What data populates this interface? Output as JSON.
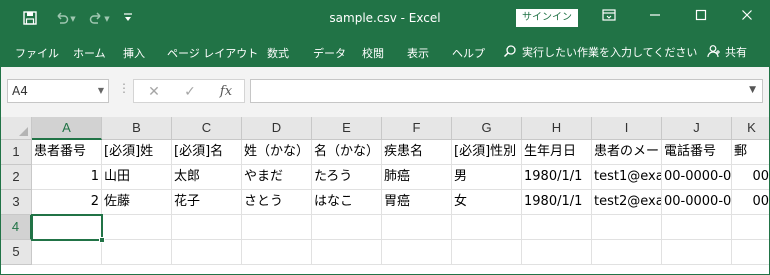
{
  "app": {
    "title": "sample.csv  -  Excel",
    "signin_label": "サインイン",
    "accent_color": "#217346"
  },
  "quick_access": {
    "save_icon": "save-icon",
    "undo_icon": "undo-icon",
    "redo_icon": "redo-icon",
    "customize_icon": "customize-qat-icon"
  },
  "window_controls": [
    "ribbon-display-options-icon",
    "minimize-icon",
    "maximize-icon",
    "close-icon"
  ],
  "ribbon": {
    "tabs": [
      "ファイル",
      "ホーム",
      "挿入",
      "ページ レイアウト",
      "数式",
      "データ",
      "校閲",
      "表示",
      "ヘルプ"
    ],
    "tell_me": "実行したい作業を入力してください",
    "share": "共有"
  },
  "formula_bar": {
    "name_box": "A4",
    "cancel_glyph": "✕",
    "enter_glyph": "✓",
    "fx_label": "fx",
    "formula_value": ""
  },
  "sheet": {
    "columns": [
      "A",
      "B",
      "C",
      "D",
      "E",
      "F",
      "G",
      "H",
      "I",
      "J",
      "K"
    ],
    "rows": [
      "1",
      "2",
      "3",
      "4",
      "5"
    ],
    "active_cell": "A4",
    "cells": [
      [
        "患者番号",
        "[必須]姓",
        "[必須]名",
        "姓（かな）",
        "名（かな）",
        "疾患名",
        "[必須]性別",
        "生年月日",
        "患者のメー",
        "電話番号",
        "郵"
      ],
      [
        "1",
        "山田",
        "太郎",
        "やまだ",
        "たろう",
        "肺癌",
        "男",
        "1980/1/1",
        "test1@exa",
        "00-0000-0",
        "00"
      ],
      [
        "2",
        "佐藤",
        "花子",
        "さとう",
        "はなこ",
        "胃癌",
        "女",
        "1980/1/1",
        "test2@exa",
        "00-0000-0",
        "00"
      ],
      [
        "",
        "",
        "",
        "",
        "",
        "",
        "",
        "",
        "",
        "",
        ""
      ],
      [
        "",
        "",
        "",
        "",
        "",
        "",
        "",
        "",
        "",
        "",
        ""
      ]
    ]
  }
}
